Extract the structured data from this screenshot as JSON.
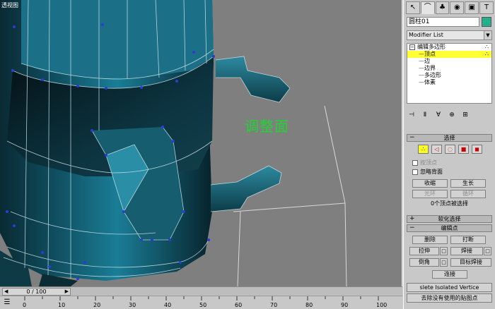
{
  "viewport": {
    "label": "透视图",
    "annotation": "调整面",
    "annotation_color": "#22d433"
  },
  "timeline": {
    "slider_text": "0 / 100",
    "ticks": [
      "0",
      "10",
      "20",
      "30",
      "40",
      "50",
      "60",
      "70",
      "80",
      "90",
      "100"
    ]
  },
  "panel": {
    "tabs": [
      {
        "icon": "create-icon",
        "glyph": "↖"
      },
      {
        "icon": "modify-icon",
        "glyph": "⌒"
      },
      {
        "icon": "hierarchy-icon",
        "glyph": "♣"
      },
      {
        "icon": "motion-icon",
        "glyph": "◉"
      },
      {
        "icon": "display-icon",
        "glyph": "▣"
      },
      {
        "icon": "utilities-icon",
        "glyph": "T"
      }
    ],
    "object_name": "圆柱01",
    "object_color": "#23b08a",
    "modifier_list": "Modifier List",
    "stack": {
      "root": "编辑多边形",
      "items": [
        "顶点",
        "边",
        "边界",
        "多边形",
        "体素"
      ],
      "selected": "顶点"
    },
    "selection": {
      "title": "选择",
      "by_vertex": "按顶点",
      "ignore_backfacing": "忽略背面",
      "shrink": "收缩",
      "grow": "生长",
      "ring": "光环",
      "loop": "循环",
      "status": "0个顶点被选择"
    },
    "soft_selection": {
      "title": "软化选择"
    },
    "edit_vertices": {
      "title": "编辑点",
      "remove": "删除",
      "break": "打断",
      "extrude": "拉伸",
      "weld": "焊接",
      "chamfer": "倒角",
      "target_weld": "目标焊接",
      "connect": "连接",
      "remove_isolated": "slete Isolated Vertice",
      "remove_unused": "去除没有使用的贴图点"
    }
  }
}
